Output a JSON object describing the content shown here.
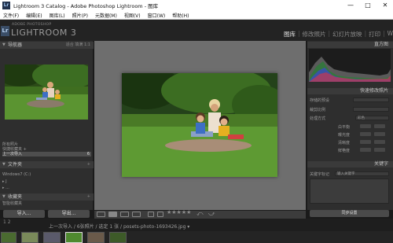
{
  "window": {
    "title": "Lightroom 3 Catalog - Adobe Photoshop Lightroom - 图库",
    "icon": "Lr",
    "controls": {
      "minimize": "—",
      "maximize": "□",
      "close": "✕"
    }
  },
  "menu": [
    "文件(F)",
    "编辑(E)",
    "图库(L)",
    "照片(P)",
    "元数据(M)",
    "视图(V)",
    "窗口(W)",
    "帮助(H)"
  ],
  "identity": {
    "small": "ADOBE PHOTOSHOP",
    "product": "LIGHTROOM 3",
    "badge": "Lr"
  },
  "modules": [
    "图库",
    "修改照片",
    "幻灯片放映",
    "打印",
    "We"
  ],
  "active_module": "图库",
  "left_panel": {
    "navigator": {
      "title": "导航器",
      "options": "适合  填满  1:1"
    },
    "catalog_rows": [
      {
        "label": "所有照片",
        "count": ""
      },
      {
        "label": "快捷收藏夹 +",
        "count": ""
      },
      {
        "label": "上一次导入",
        "count": "6",
        "selected": true
      }
    ],
    "folders": {
      "title": "文件夹",
      "rows": [
        {
          "label": "Windows7 (C:)",
          "count": ""
        },
        {
          "label": "▸ J",
          "count": ""
        },
        {
          "label": "  ▸ ...",
          "count": ""
        }
      ]
    },
    "collections": {
      "title": "收藏夹",
      "row": "智能收藏夹"
    },
    "import_button": "导入...",
    "export_button": "导出..."
  },
  "right_panel": {
    "histogram": {
      "title": "直方图"
    },
    "quick_develop": {
      "title": "快速修改照片",
      "saved_preset_label": "存储的预设",
      "crop_label": "裁剪比例",
      "treatment_label": "处理方式",
      "treatment_value": "彩色",
      "white_balance": "白平衡",
      "exposure": "曝光度",
      "clarity": "清晰度",
      "vibrance": "鲜艳度"
    },
    "keywording": {
      "title": "关键字",
      "tags_label": "关键字标记",
      "input_placeholder": "输入关键字"
    },
    "sync_button": "同步设置"
  },
  "toolbar": {
    "stars": "★★★★★"
  },
  "filmstrip": {
    "monitors": "1 2",
    "path": "上一次导入 / 6张照片 / 选定 1 张 / posets-photo-1693426.jpg ▾"
  },
  "image_colors": {
    "grass": "#4f8a2f",
    "hedge": "#3c6d22",
    "sky": "#1e3a12"
  }
}
